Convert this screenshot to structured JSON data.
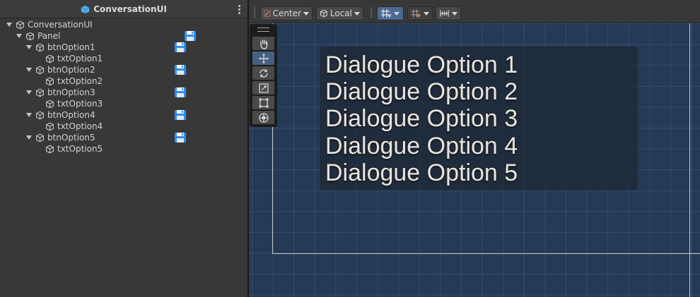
{
  "hierarchy": {
    "title": "ConversationUI",
    "items": [
      {
        "label": "ConversationUI"
      },
      {
        "label": "Panel"
      },
      {
        "label": "btnOption1"
      },
      {
        "label": "txtOption1"
      },
      {
        "label": "btnOption2"
      },
      {
        "label": "txtOption2"
      },
      {
        "label": "btnOption3"
      },
      {
        "label": "txtOption3"
      },
      {
        "label": "btnOption4"
      },
      {
        "label": "txtOption4"
      },
      {
        "label": "btnOption5"
      },
      {
        "label": "txtOption5"
      }
    ]
  },
  "scene_toolbar": {
    "pivot_label": "Center",
    "space_label": "Local"
  },
  "scene": {
    "options": [
      "Dialogue Option 1",
      "Dialogue Option 2",
      "Dialogue Option 3",
      "Dialogue Option 4",
      "Dialogue Option 5"
    ]
  },
  "tools": [
    "hand-tool",
    "move-tool",
    "rotate-tool",
    "scale-tool",
    "rect-tool",
    "transform-tool"
  ],
  "colors": {
    "scene_background": "#253a56",
    "panel_background": "#383838",
    "active_tool": "#46607f",
    "save_icon": "#2f8cf0"
  }
}
